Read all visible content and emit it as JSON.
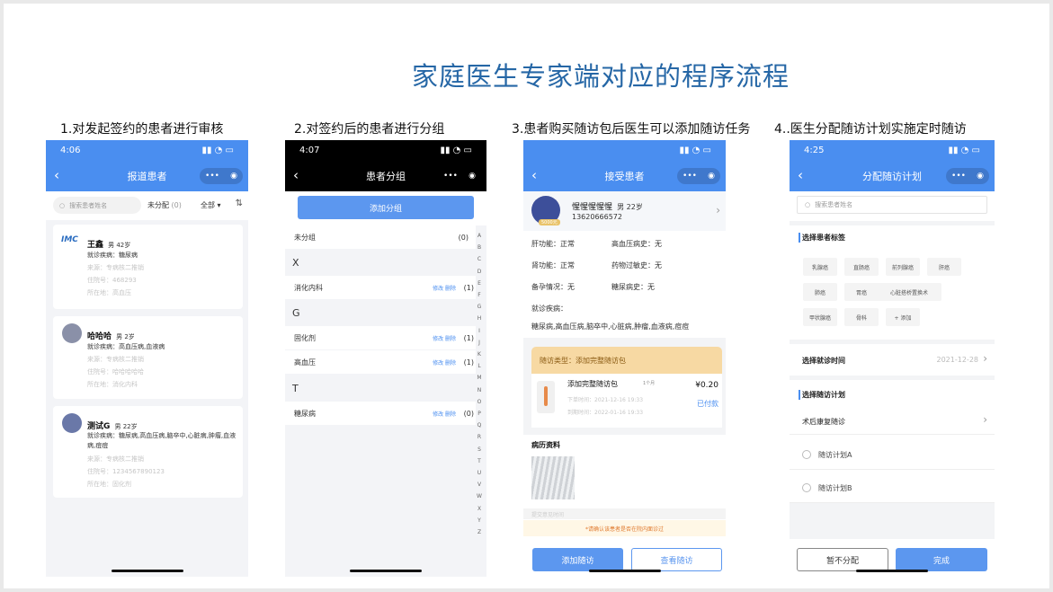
{
  "title": "家庭医生专家端对应的程序流程",
  "steps": [
    "1.对发起签约的患者进行审核",
    "2.对签约后的患者进行分组",
    "3.患者购买随访包后医生可以添加随访任务",
    "4..医生分配随访计划实施定时随访"
  ],
  "p1": {
    "time": "4:06",
    "nav_title": "报道患者",
    "search_placeholder": "搜索患者姓名",
    "filter_unassigned": "未分配",
    "filter_count": "(0)",
    "filter_all": "全部",
    "patients": [
      {
        "name": "王鑫",
        "meta": "男 42岁",
        "disease": "就诊疾病：糖尿病",
        "l2": "来源：专病核二推销",
        "l3": "住院号：468293",
        "l4": "所在地：高血压"
      },
      {
        "name": "哈哈哈",
        "meta": "男 2岁",
        "disease": "就诊疾病：高血压病,血液病",
        "l2": "来源：专病核二推销",
        "l3": "住院号：哈哈哈哈哈",
        "l4": "所在地：消化内科"
      },
      {
        "name": "测试G",
        "meta": "男 22岁",
        "disease": "就诊疾病：糖尿病,高血压病,脑卒中,心脏病,肿瘤,血液病,痘痘",
        "l2": "来源：专病核二推销",
        "l3": "住院号：1234567890123",
        "l4": "所在地：固化剂"
      }
    ]
  },
  "p2": {
    "time": "4:07",
    "nav_title": "患者分组",
    "add_btn": "添加分组",
    "ungrouped": "未分组",
    "ungrouped_count": "(0)",
    "groups": [
      {
        "letter": "X",
        "items": [
          {
            "name": "消化内科",
            "count": "(1)"
          }
        ]
      },
      {
        "letter": "G",
        "items": [
          {
            "name": "固化剂",
            "count": "(1)"
          },
          {
            "name": "高血压",
            "count": "(1)"
          }
        ]
      },
      {
        "letter": "T",
        "items": [
          {
            "name": "糖尿病",
            "count": "(0)"
          }
        ]
      }
    ],
    "ops": "修改  删除",
    "index": [
      "A",
      "B",
      "C",
      "D",
      "E",
      "F",
      "G",
      "H",
      "I",
      "J",
      "K",
      "L",
      "M",
      "N",
      "O",
      "P",
      "Q",
      "R",
      "S",
      "T",
      "U",
      "V",
      "W",
      "X",
      "Y",
      "Z"
    ]
  },
  "p3": {
    "time": "",
    "nav_title": "接受患者",
    "name": "惺惺惺惺惺",
    "meta": "男 22岁",
    "phone": "13620666572",
    "avatar_badge": "5000元",
    "info": [
      [
        "肝功能：正常",
        "高血压病史：无"
      ],
      [
        "肾功能：正常",
        "药物过敏史：无"
      ],
      [
        "备孕情况：无",
        "糖尿病史：无"
      ]
    ],
    "disease_label": "就诊疾病：",
    "diseases": "糖尿病,高血压病,脑卒中,心脏病,肿瘤,血液病,痘痘",
    "pkg_type": "随访类型：添加完整随访包",
    "pkg_name": "添加完整随访包",
    "pkg_unit": "1个月",
    "pkg_price": "¥0.20",
    "pkg_status": "已付款",
    "pkg_l1": "下单时间：2021-12-16 19:33",
    "pkg_l2": "到期时间：2022-01-16 19:33",
    "records": "病历资料",
    "notice": "*请确认该患者是否在院内面诊过",
    "notice_prev": "提交意见时间",
    "btn_add": "添加随访",
    "btn_view": "查看随访"
  },
  "p4": {
    "time": "4:25",
    "nav_title": "分配随访计划",
    "search_placeholder": "搜索患者姓名",
    "sec_tags": "选择患者标签",
    "tags": [
      "乳腺癌",
      "直肠癌",
      "前列腺癌",
      "肝癌",
      "肺癌",
      "胃癌",
      "心脏搭桥置换术",
      "甲状腺癌",
      "骨科",
      "+ 添加"
    ],
    "visit_time_label": "选择就诊时间",
    "visit_time_value": "2021-12-28",
    "sec_plan": "选择随访计划",
    "plan_type": "术后康复随诊",
    "plans": [
      "随访计划A",
      "随访计划B"
    ],
    "btn_no": "暂不分配",
    "btn_done": "完成"
  },
  "colors": {
    "accent": "#4a8ef0",
    "title": "#2667a6"
  }
}
